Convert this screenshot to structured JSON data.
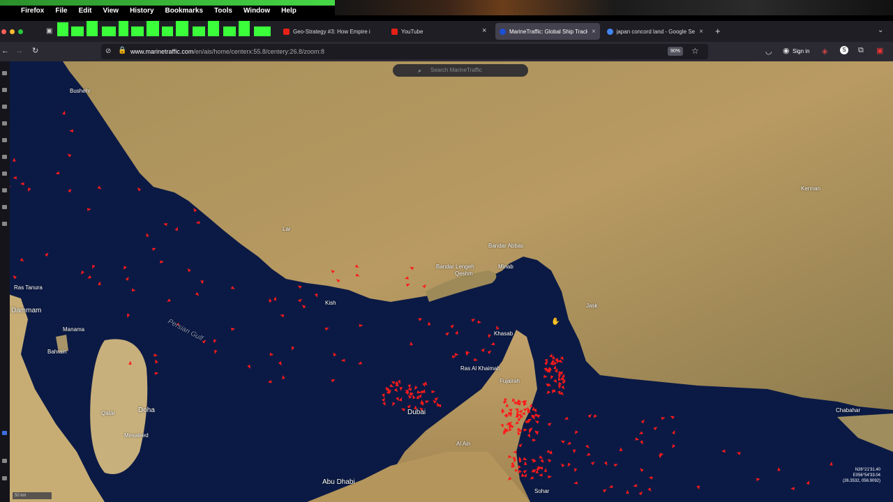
{
  "menubar": {
    "apple_glyph": "",
    "items": [
      "Firefox",
      "File",
      "Edit",
      "View",
      "History",
      "Bookmarks",
      "Tools",
      "Window",
      "Help"
    ]
  },
  "tabs": [
    {
      "title": "Geo-Strategy #3: How Empire i",
      "favicon_color": "#e62117"
    },
    {
      "title": "YouTube",
      "favicon_color": "#e62117"
    },
    {
      "title": "MarineTraffic: Global Ship Track",
      "favicon_color": "#1e4fd8",
      "active": true
    },
    {
      "title": "japan concord land - Google Se",
      "favicon_color": "#4285f4"
    }
  ],
  "new_tab_label": "+",
  "close_glyph": "×",
  "navbar": {
    "url_domain": "www.marinetraffic.com",
    "url_path": "/en/ais/home/centerx:55.8/centery:26.8/zoom:8",
    "zoom": "90%",
    "signin": "Sign in"
  },
  "map": {
    "search_placeholder": "Search MarineTraffic",
    "labels": [
      {
        "text": "Bushehr",
        "cls": ""
      },
      {
        "text": "Persian Gulf",
        "cls": "sea"
      },
      {
        "text": "Bandar Abbas",
        "cls": ""
      },
      {
        "text": "Qeshm",
        "cls": ""
      },
      {
        "text": "Khasab",
        "cls": ""
      },
      {
        "text": "Ras Al Khaimah",
        "cls": ""
      },
      {
        "text": "Dubai",
        "cls": "big"
      },
      {
        "text": "Abu Dhabi",
        "cls": "big"
      },
      {
        "text": "Doha",
        "cls": "big"
      },
      {
        "text": "Manama",
        "cls": ""
      },
      {
        "text": "Bahrain",
        "cls": ""
      },
      {
        "text": "Qatar",
        "cls": ""
      },
      {
        "text": "Dammam",
        "cls": "big"
      },
      {
        "text": "Kish",
        "cls": ""
      },
      {
        "text": "Fujairah",
        "cls": ""
      },
      {
        "text": "Sohar",
        "cls": ""
      },
      {
        "text": "Chabahar",
        "cls": ""
      },
      {
        "text": "Jask",
        "cls": ""
      },
      {
        "text": "Minab",
        "cls": ""
      },
      {
        "text": "Lar",
        "cls": ""
      },
      {
        "text": "Mesaieed",
        "cls": ""
      },
      {
        "text": "Ras Tanura",
        "cls": ""
      },
      {
        "text": "Al Ain",
        "cls": ""
      },
      {
        "text": "Bandar Lengeh",
        "cls": ""
      },
      {
        "text": "Kerman",
        "cls": ""
      }
    ],
    "coords": [
      "N26°21'31.40",
      "E056°54'33.04",
      "(26.3532, 056.9092)"
    ],
    "scale": "50 km"
  }
}
